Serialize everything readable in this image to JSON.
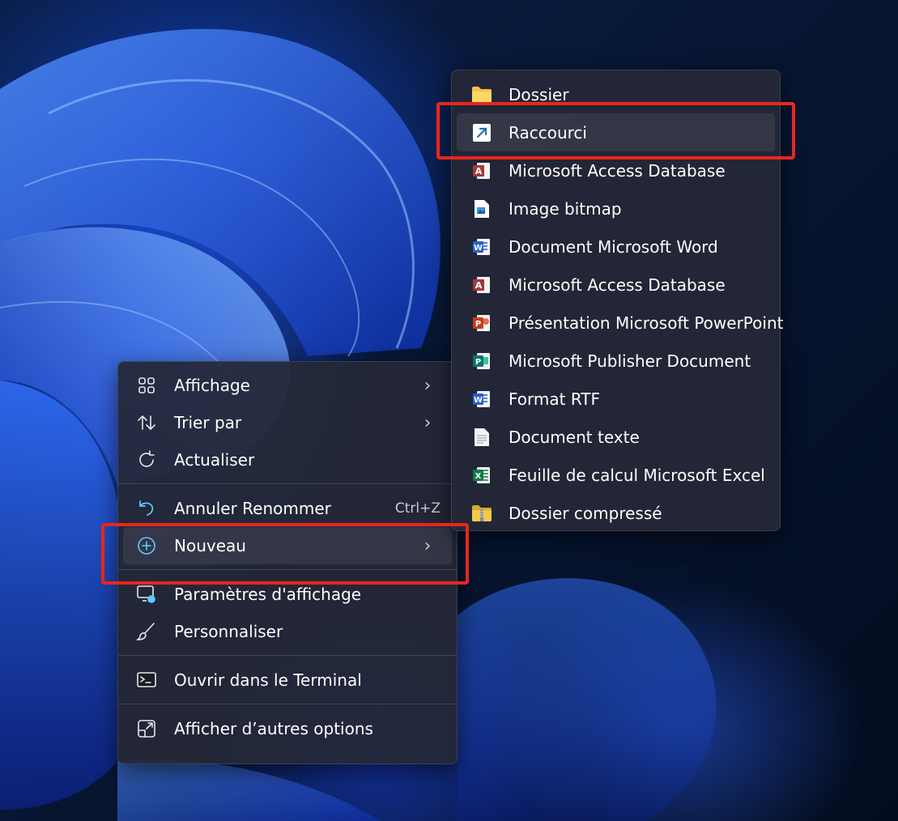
{
  "context_menu": {
    "items": [
      {
        "label": "Affichage",
        "icon": "grid-icon",
        "submenu": true
      },
      {
        "label": "Trier par",
        "icon": "sort-arrows-icon",
        "submenu": true
      },
      {
        "label": "Actualiser",
        "icon": "refresh-icon"
      },
      {
        "label": "Annuler Renommer",
        "icon": "undo-icon",
        "shortcut": "Ctrl+Z"
      },
      {
        "label": "Nouveau",
        "icon": "plus-circle-icon",
        "submenu": true,
        "highlighted": true
      },
      {
        "label": "Paramètres d'affichage",
        "icon": "display-settings-icon"
      },
      {
        "label": "Personnaliser",
        "icon": "brush-icon"
      },
      {
        "label": "Ouvrir dans le Terminal",
        "icon": "terminal-icon"
      },
      {
        "label": "Afficher d’autres options",
        "icon": "more-options-icon"
      }
    ]
  },
  "new_submenu": {
    "items": [
      {
        "label": "Dossier",
        "icon": "folder-icon"
      },
      {
        "label": "Raccourci",
        "icon": "shortcut-icon",
        "highlighted": true
      },
      {
        "label": "Microsoft Access Database",
        "icon": "access-icon"
      },
      {
        "label": "Image bitmap",
        "icon": "bitmap-icon"
      },
      {
        "label": "Document Microsoft Word",
        "icon": "word-icon"
      },
      {
        "label": "Microsoft Access Database",
        "icon": "access-icon"
      },
      {
        "label": "Présentation Microsoft PowerPoint",
        "icon": "powerpoint-icon"
      },
      {
        "label": "Microsoft Publisher Document",
        "icon": "publisher-icon"
      },
      {
        "label": "Format RTF",
        "icon": "rtf-icon"
      },
      {
        "label": "Document texte",
        "icon": "text-document-icon"
      },
      {
        "label": "Feuille de calcul Microsoft Excel",
        "icon": "excel-icon"
      },
      {
        "label": "Dossier compressé",
        "icon": "zip-folder-icon"
      }
    ]
  },
  "icon_glyphs": {
    "chevron": "›",
    "word_letter": "W",
    "access_letter": "A",
    "powerpoint_letter": "P",
    "publisher_letter": "P",
    "excel_letter": "X"
  },
  "colors": {
    "accent": "#60cdff",
    "highlight_box": "#e8261c",
    "word": "#2b5fc7",
    "access": "#a4373a",
    "powerpoint": "#c43e1c",
    "publisher": "#077568",
    "excel": "#107c41",
    "folder": "#f3c14a"
  }
}
